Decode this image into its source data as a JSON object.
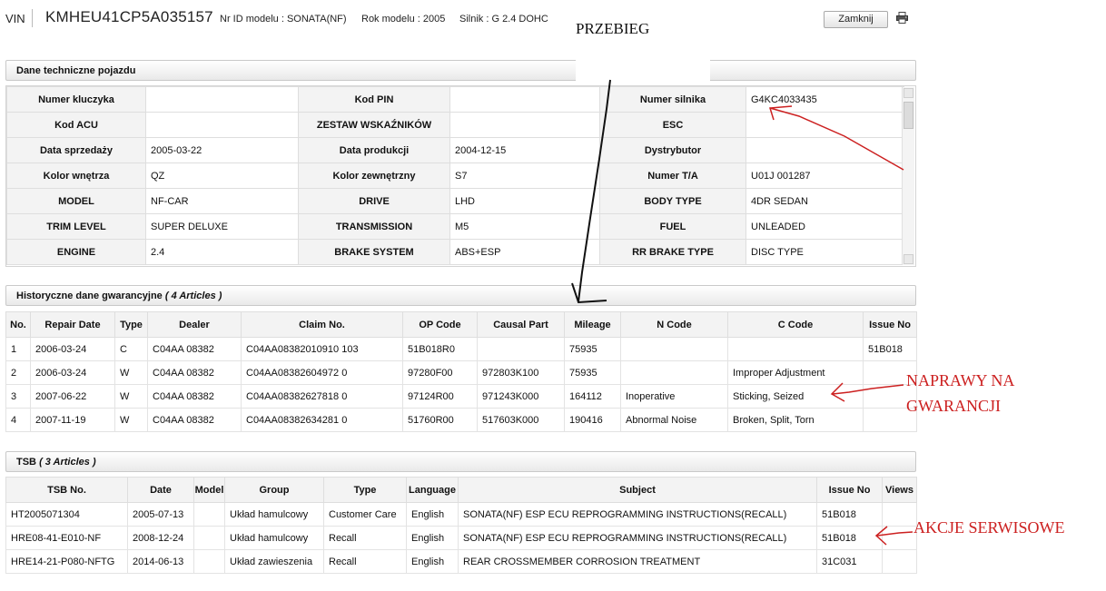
{
  "header": {
    "vin_label": "VIN",
    "vin": "KMHEU41CP5A035157",
    "model_id": "Nr ID modelu : SONATA(NF)",
    "model_year": "Rok modelu : 2005",
    "engine": "Silnik : G 2.4 DOHC",
    "close_label": "Zamknij",
    "print_icon": "print-icon"
  },
  "tech": {
    "title": "Dane techniczne pojazdu",
    "rows": [
      [
        {
          "l": "Numer kluczyka",
          "v": ""
        },
        {
          "l": "Kod PIN",
          "v": ""
        },
        {
          "l": "Numer silnika",
          "v": "G4KC4033435"
        }
      ],
      [
        {
          "l": "Kod ACU",
          "v": ""
        },
        {
          "l": "ZESTAW WSKAŹNIKÓW",
          "v": ""
        },
        {
          "l": "ESC",
          "v": ""
        }
      ],
      [
        {
          "l": "Data sprzedaży",
          "v": "2005-03-22"
        },
        {
          "l": "Data produkcji",
          "v": "2004-12-15"
        },
        {
          "l": "Dystrybutor",
          "v": ""
        }
      ],
      [
        {
          "l": "Kolor wnętrza",
          "v": "QZ"
        },
        {
          "l": "Kolor zewnętrzny",
          "v": "S7"
        },
        {
          "l": "Numer T/A",
          "v": "U01J 001287"
        }
      ],
      [
        {
          "l": "MODEL",
          "v": "NF-CAR"
        },
        {
          "l": "DRIVE",
          "v": "LHD"
        },
        {
          "l": "BODY TYPE",
          "v": "4DR SEDAN"
        }
      ],
      [
        {
          "l": "TRIM LEVEL",
          "v": "SUPER DELUXE"
        },
        {
          "l": "TRANSMISSION",
          "v": "M5"
        },
        {
          "l": "FUEL",
          "v": "UNLEADED"
        }
      ],
      [
        {
          "l": "ENGINE",
          "v": "2.4"
        },
        {
          "l": "BRAKE SYSTEM",
          "v": "ABS+ESP"
        },
        {
          "l": "RR BRAKE TYPE",
          "v": "DISC TYPE"
        }
      ]
    ]
  },
  "warranty": {
    "title": "Historyczne dane gwarancyjne",
    "count": "( 4 Articles )",
    "columns": [
      "No.",
      "Repair Date",
      "Type",
      "Dealer",
      "Claim No.",
      "OP Code",
      "Causal Part",
      "Mileage",
      "N Code",
      "C Code",
      "Issue No"
    ],
    "rows": [
      [
        "1",
        "2006-03-24",
        "C",
        "C04AA 08382",
        "C04AA08382010910 103",
        "51B018R0",
        "",
        "75935",
        "",
        "",
        "51B018"
      ],
      [
        "2",
        "2006-03-24",
        "W",
        "C04AA 08382",
        "C04AA08382604972 0",
        "97280F00",
        "972803K100",
        "75935",
        "",
        "Improper Adjustment",
        ""
      ],
      [
        "3",
        "2007-06-22",
        "W",
        "C04AA 08382",
        "C04AA08382627818 0",
        "97124R00",
        "971243K000",
        "164112",
        "Inoperative",
        "Sticking, Seized",
        ""
      ],
      [
        "4",
        "2007-11-19",
        "W",
        "C04AA 08382",
        "C04AA08382634281 0",
        "51760R00",
        "517603K000",
        "190416",
        "Abnormal Noise",
        "Broken, Split, Torn",
        ""
      ]
    ]
  },
  "tsb": {
    "title": "TSB",
    "count": "( 3 Articles )",
    "columns": [
      "TSB No.",
      "Date",
      "Model",
      "Group",
      "Type",
      "Language",
      "Subject",
      "Issue No",
      "Views"
    ],
    "rows": [
      [
        "HT2005071304",
        "2005-07-13",
        "",
        "Układ hamulcowy",
        "Customer Care",
        "English",
        "SONATA(NF) ESP ECU REPROGRAMMING INSTRUCTIONS(RECALL)",
        "51B018",
        ""
      ],
      [
        "HRE08-41-E010-NF",
        "2008-12-24",
        "",
        "Układ hamulcowy",
        "Recall",
        "English",
        "SONATA(NF) ESP ECU REPROGRAMMING INSTRUCTIONS(RECALL)",
        "51B018",
        ""
      ],
      [
        "HRE14-21-P080-NFTG",
        "2014-06-13",
        "",
        "Układ zawieszenia",
        "Recall",
        "English",
        "REAR CROSSMEMBER CORROSION TREATMENT",
        "31C031",
        ""
      ]
    ]
  },
  "annotations": {
    "przebieg": "PRZEBIEG",
    "naprawy_line1": "NAPRAWY NA",
    "naprawy_line2": "GWARANCJI",
    "akcje": "AKCJE SERWISOWE",
    "ink_color": "#cc2020"
  }
}
